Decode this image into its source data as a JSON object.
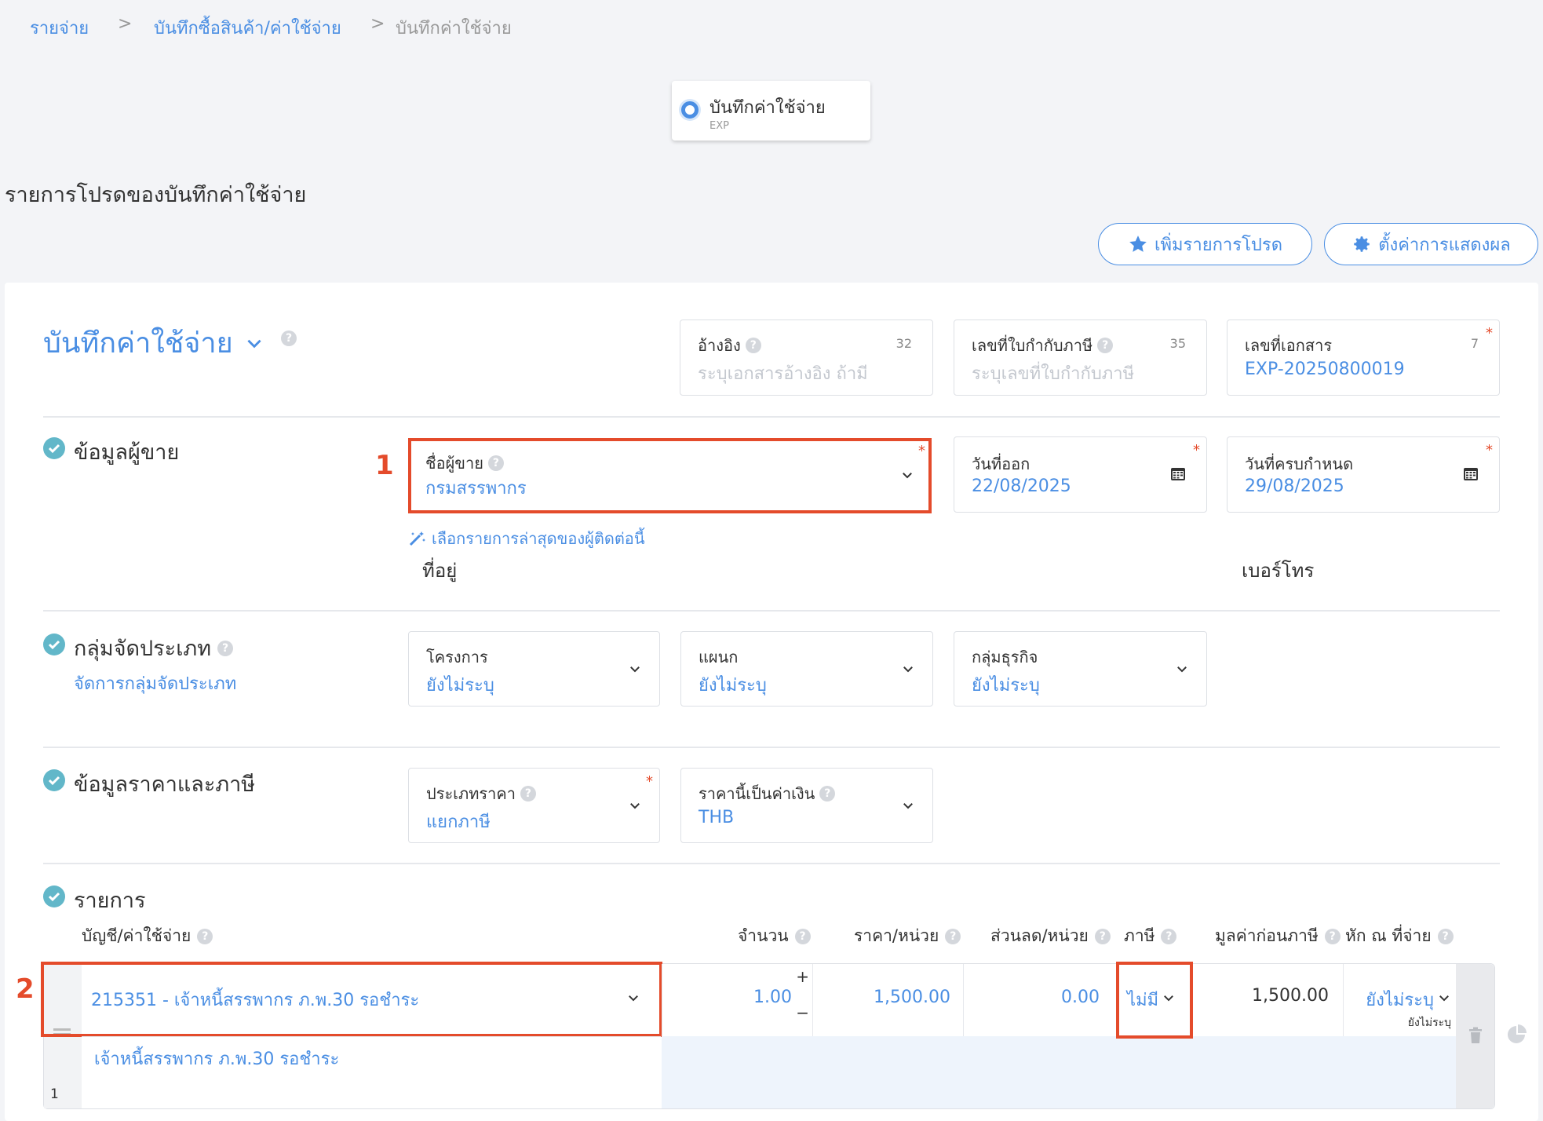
{
  "breadcrumb": {
    "items": [
      "รายจ่าย",
      "บันทึกซื้อสินค้า/ค่าใช้จ่าย",
      "บันทึกค่าใช้จ่าย"
    ],
    "separator": ">"
  },
  "doc_type": {
    "label": "บันทึกค่าใช้จ่าย",
    "code": "EXP"
  },
  "favorites": {
    "title": "รายการโปรดของบันทึกค่าใช้จ่าย",
    "add_button": "เพิ่มรายการโปรด",
    "settings_button": "ตั้งค่าการแสดงผล"
  },
  "form": {
    "title": "บันทึกค่าใช้จ่าย",
    "reference": {
      "label": "อ้างอิง",
      "placeholder": "ระบุเอกสารอ้างอิง ถ้ามี",
      "max": "32"
    },
    "tax_invoice": {
      "label": "เลขที่ใบกำกับภาษี",
      "placeholder": "ระบุเลขที่ใบกำกับภาษี",
      "max": "35"
    },
    "doc_number": {
      "label": "เลขที่เอกสาร",
      "value": "EXP-20250800019",
      "max": "7",
      "required": "*"
    }
  },
  "vendor": {
    "section_title": "ข้อมูลผู้ขาย",
    "annotation": "1",
    "name_label": "ชื่อผู้ขาย",
    "name_value": "กรมสรรพากร",
    "required": "*",
    "issue_date_label": "วันที่ออก",
    "issue_date": "22/08/2025",
    "due_date_label": "วันที่ครบกำหนด",
    "due_date": "29/08/2025",
    "latest_link": "เลือกรายการล่าสุดของผู้ติดต่อนี้",
    "address_label": "ที่อยู่",
    "phone_label": "เบอร์โทร"
  },
  "classification": {
    "section_title": "กลุ่มจัดประเภท",
    "manage_link": "จัดการกลุ่มจัดประเภท",
    "project_label": "โครงการ",
    "project_value": "ยังไม่ระบุ",
    "department_label": "แผนก",
    "department_value": "ยังไม่ระบุ",
    "business_label": "กลุ่มธุรกิจ",
    "business_value": "ยังไม่ระบุ"
  },
  "pricing": {
    "section_title": "ข้อมูลราคาและภาษี",
    "price_type_label": "ประเภทราคา",
    "price_type_value": "แยกภาษี",
    "currency_label": "ราคานี้เป็นค่าเงิน",
    "currency_value": "THB",
    "required": "*"
  },
  "items": {
    "section_title": "รายการ",
    "annotation": "2",
    "columns": {
      "account": "บัญชี/ค่าใช้จ่าย",
      "quantity": "จำนวน",
      "unit_price": "ราคา/หน่วย",
      "discount": "ส่วนลด/หน่วย",
      "tax": "ภาษี",
      "pre_tax": "มูลค่าก่อนภาษี",
      "withholding": "หัก ณ ที่จ่าย"
    },
    "row": {
      "index": "1",
      "account": "215351 - เจ้าหนี้สรรพากร ภ.พ.30 รอชำระ",
      "description": "เจ้าหนี้สรรพากร ภ.พ.30 รอชำระ",
      "quantity": "1.00",
      "plus": "+",
      "minus": "−",
      "unit_price": "1,500.00",
      "discount": "0.00",
      "tax": "ไม่มี",
      "pre_tax": "1,500.00",
      "withholding": "ยังไม่ระบุ",
      "withholding_sub": "ยังไม่ระบุ"
    }
  },
  "colors": {
    "accent": "#4a8ee3",
    "annotation": "#e44b2b",
    "check": "#62b7c9"
  }
}
